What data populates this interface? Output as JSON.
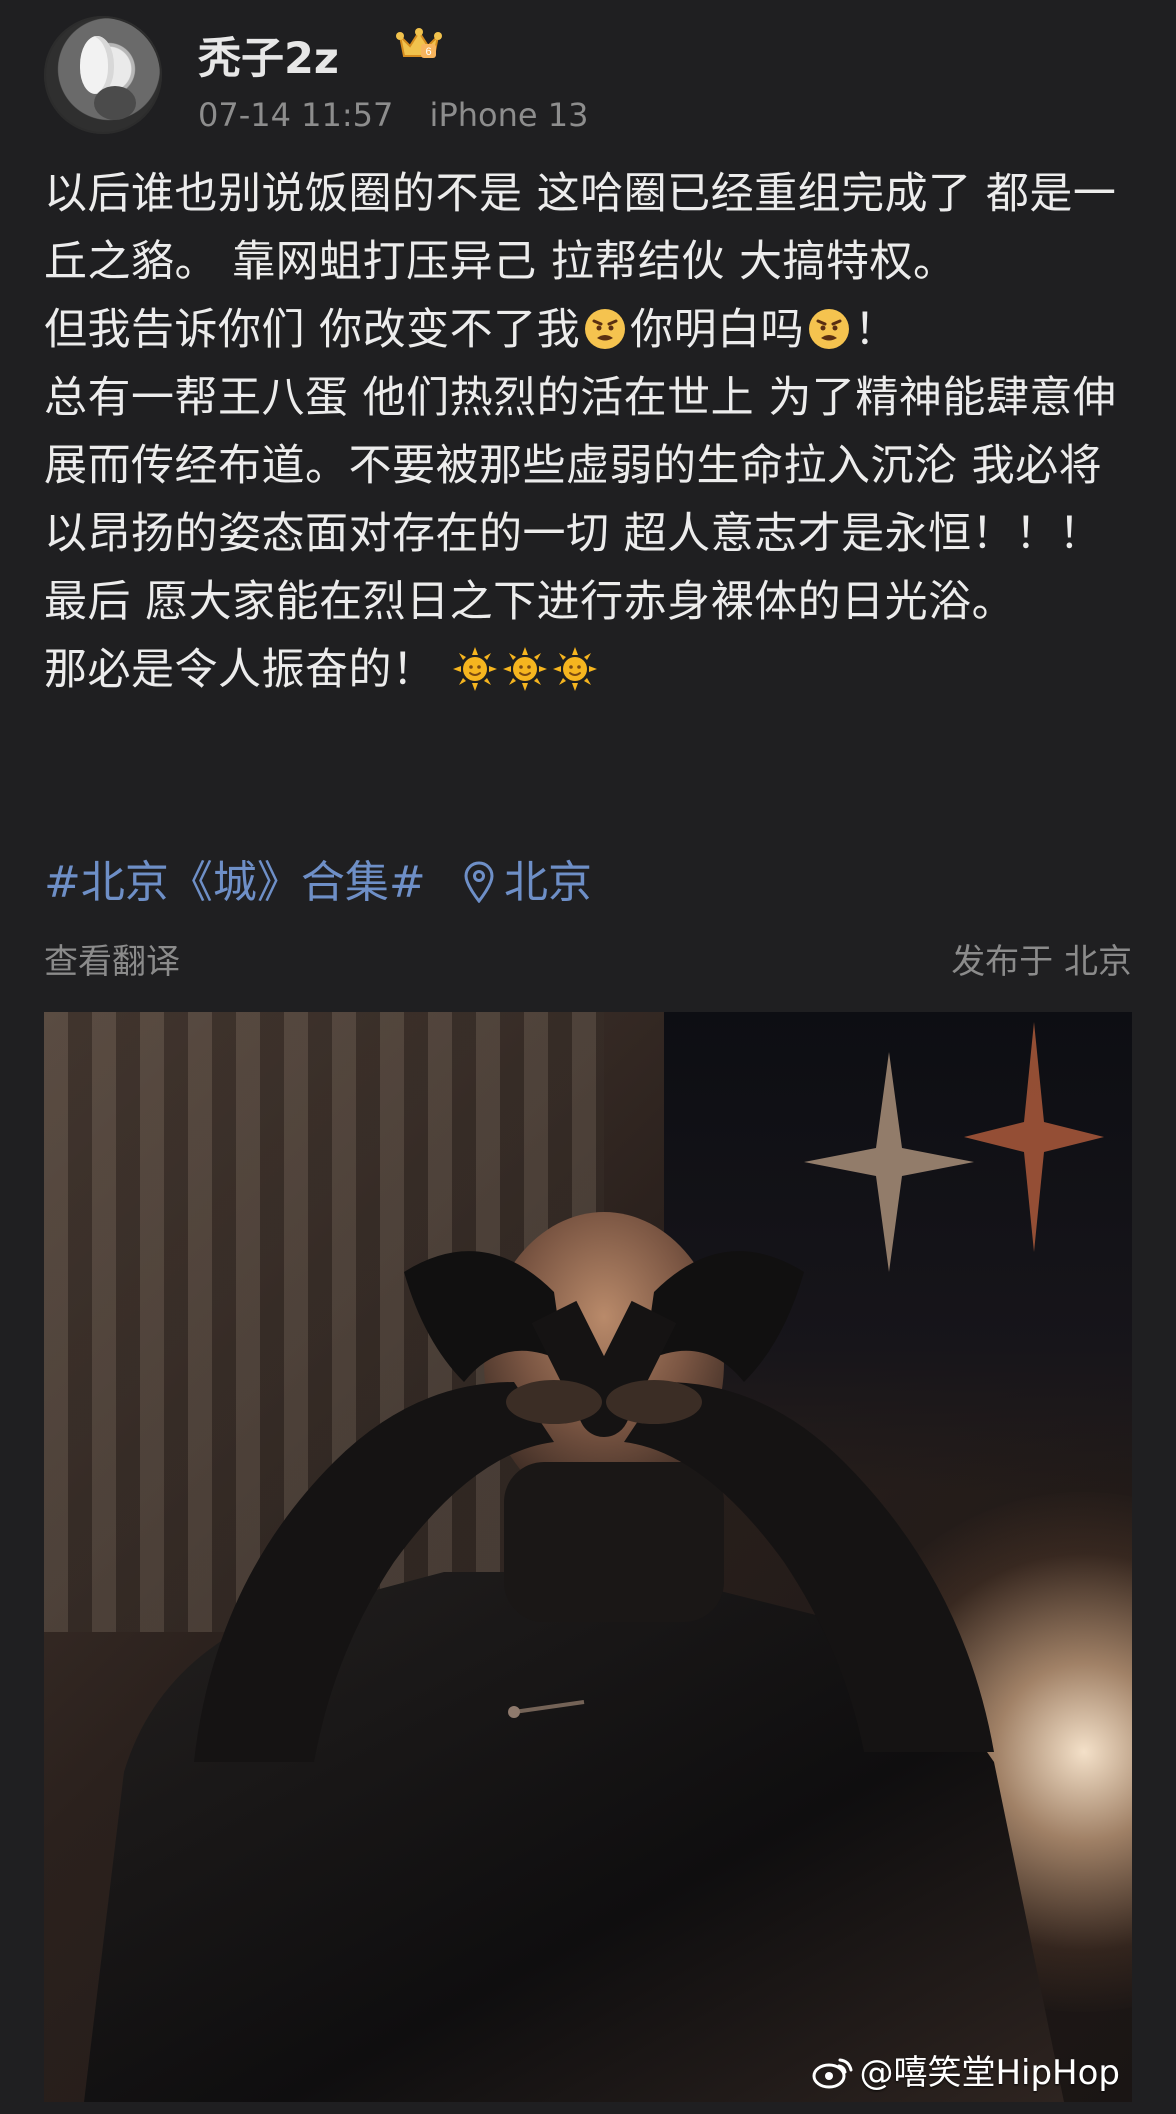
{
  "post": {
    "username": "秃子2z",
    "badge_icon": "crown-badge-icon",
    "timestamp": "07-14 11:57",
    "device": "iPhone 13",
    "paragraphs": [
      {
        "text": "以后谁也别说饭圈的不是 这哈圈已经重组完成了 都是一丘之貉。 靠网蛆打压异己 拉帮结伙 大搞特权。"
      },
      {
        "before": "但我告诉你们 你改变不了我",
        "middle": "你明白吗",
        "after": "！"
      },
      {
        "text": "总有一帮王八蛋 他们热烈的活在世上 为了精神能肆意伸展而传经布道。不要被那些虚弱的生命拉入沉沦 我必将以昂扬的姿态面对存在的一切 超人意志才是永恒！！！"
      },
      {
        "text": "最后 愿大家能在烈日之下进行赤身裸体的日光浴。"
      },
      {
        "text": "那必是令人振奋的！"
      }
    ],
    "topic": "#北京《城》合集#",
    "location": "北京",
    "translate_label": "查看翻译",
    "published_label": "发布于 北京",
    "watermark": "@嘻笑堂HipHop"
  },
  "colors": {
    "background": "#1f1f21",
    "link": "#6e8fc7",
    "meta_text": "#8d8d8d"
  }
}
